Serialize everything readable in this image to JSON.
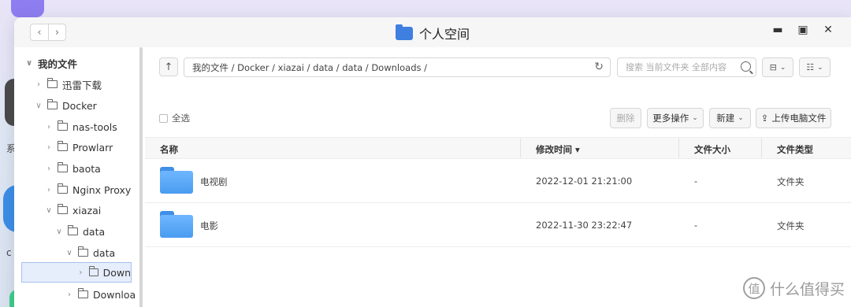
{
  "desktop": {
    "label_1": "系",
    "label_2": "c"
  },
  "window": {
    "title": "个人空间",
    "back": "‹",
    "forward": "›",
    "minimize": "▬",
    "maximize": "▣",
    "close": "✕"
  },
  "sidebar": {
    "items": [
      {
        "label": "我的文件",
        "caret": "∨"
      },
      {
        "label": "迅雷下载",
        "caret": "›"
      },
      {
        "label": "Docker",
        "caret": "∨"
      },
      {
        "label": "nas-tools",
        "caret": "›"
      },
      {
        "label": "Prowlarr",
        "caret": "›"
      },
      {
        "label": "baota",
        "caret": "›"
      },
      {
        "label": "Nginx Proxy",
        "caret": "›"
      },
      {
        "label": "xiazai",
        "caret": "∨"
      },
      {
        "label": "data",
        "caret": "∨"
      },
      {
        "label": "data",
        "caret": "∨"
      },
      {
        "label": "Down",
        "caret": "›"
      },
      {
        "label": "Downloa",
        "caret": "›"
      }
    ]
  },
  "toolbar": {
    "up": "↑",
    "path": "我的文件 / Docker / xiazai / data / data / Downloads /",
    "refresh": "↻",
    "search_placeholder": "搜索 当前文件夹 全部内容",
    "filter_icon": "⊟",
    "view_icon": "☷",
    "dd": "⌄",
    "select_all": "全选",
    "delete": "删除",
    "more_actions": "更多操作",
    "new": "新建",
    "upload": "上传电脑文件",
    "upload_icon": "⇪"
  },
  "table": {
    "headers": {
      "name": "名称",
      "modified": "修改时间",
      "sort_arrow": "▾",
      "size": "文件大小",
      "type": "文件类型"
    },
    "rows": [
      {
        "name": "电视剧",
        "modified": "2022-12-01 21:21:00",
        "size": "-",
        "type": "文件夹"
      },
      {
        "name": "电影",
        "modified": "2022-11-30 23:22:47",
        "size": "-",
        "type": "文件夹"
      }
    ]
  },
  "watermark": {
    "logo": "值",
    "text": "什么值得买"
  }
}
